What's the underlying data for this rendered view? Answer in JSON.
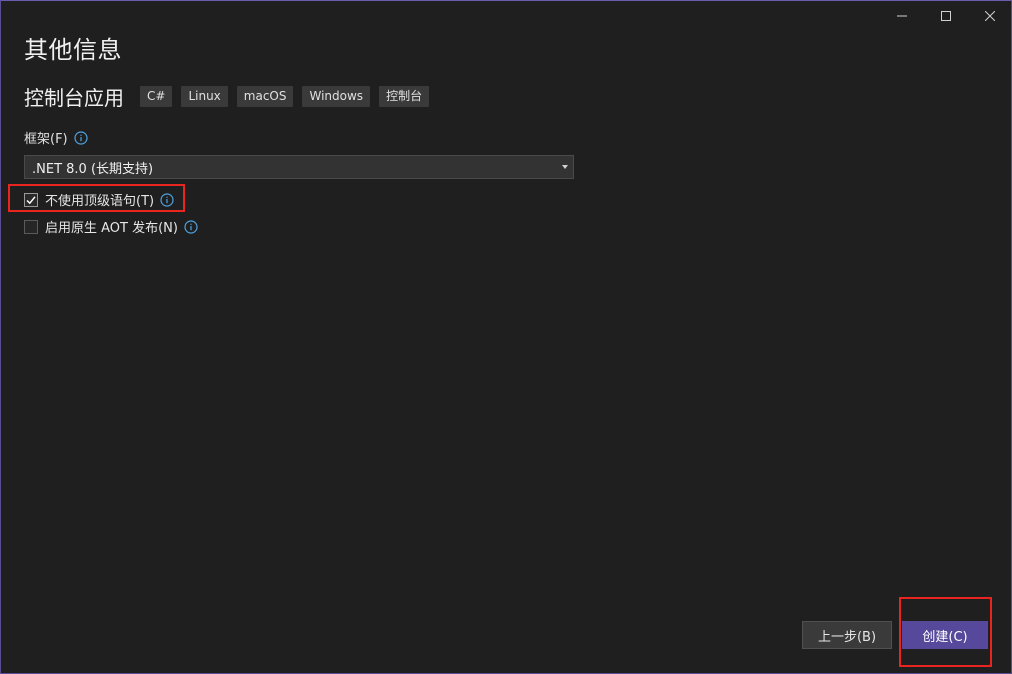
{
  "page": {
    "title": "其他信息"
  },
  "template": {
    "name": "控制台应用",
    "tags": [
      "C#",
      "Linux",
      "macOS",
      "Windows",
      "控制台"
    ]
  },
  "framework": {
    "label": "框架(F)",
    "selected": ".NET 8.0 (长期支持)"
  },
  "options": {
    "top_level_statements": {
      "label": "不使用顶级语句(T)",
      "checked": true
    },
    "native_aot": {
      "label": "启用原生 AOT 发布(N)",
      "checked": false
    }
  },
  "buttons": {
    "back_label": "上一步(B)",
    "create_label": "创建(C)"
  },
  "colors": {
    "background": "#1f1f1f",
    "accent": "#56489b",
    "info_icon": "#4fa3e0",
    "highlight": "#e8251f"
  },
  "icons": {
    "minimize": "minimize-icon",
    "maximize": "maximize-icon",
    "close": "close-icon",
    "info": "info-icon",
    "checkmark": "checkmark-icon",
    "dropdown": "chevron-down-icon"
  }
}
